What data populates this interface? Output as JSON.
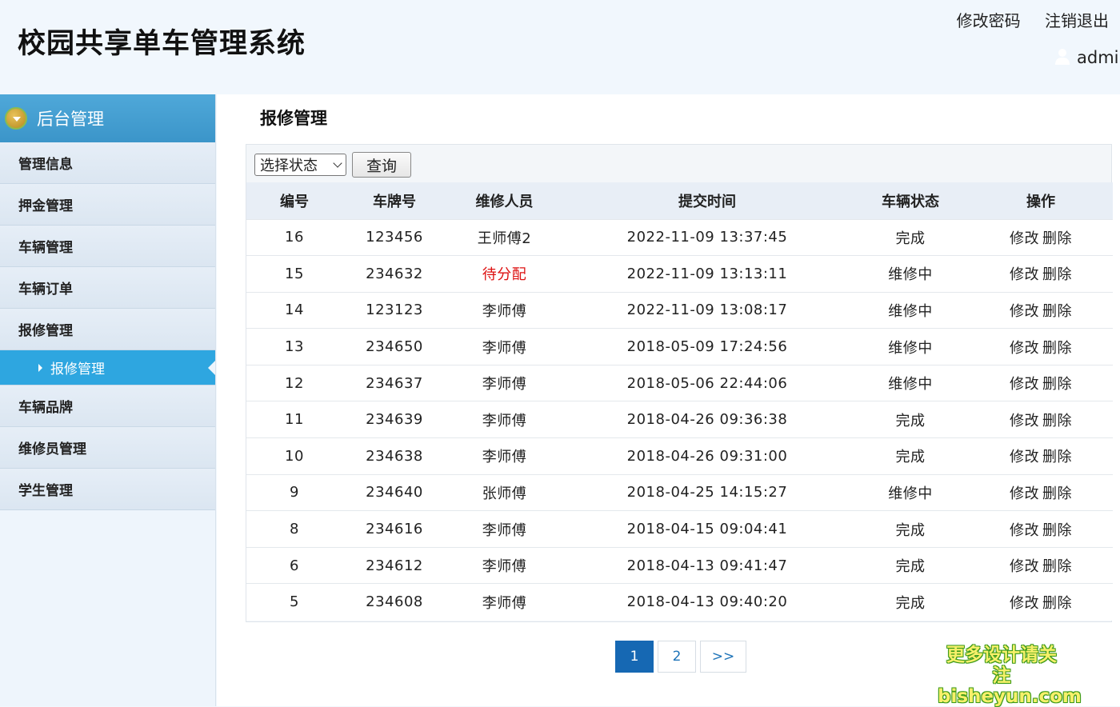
{
  "header": {
    "title": "校园共享单车管理系统",
    "change_password": "修改密码",
    "logout": "注销退出",
    "username": "admi"
  },
  "sidebar": {
    "head": "后台管理",
    "items": [
      {
        "label": "管理信息"
      },
      {
        "label": "押金管理"
      },
      {
        "label": "车辆管理"
      },
      {
        "label": "车辆订单"
      },
      {
        "label": "报修管理"
      },
      {
        "label": "车辆品牌"
      },
      {
        "label": "维修员管理"
      },
      {
        "label": "学生管理"
      }
    ],
    "active_sub": "报修管理"
  },
  "main": {
    "title": "报修管理",
    "filter": {
      "selected": "选择状态",
      "query_label": "查询"
    },
    "columns": [
      "编号",
      "车牌号",
      "维修人员",
      "提交时间",
      "车辆状态",
      "操作"
    ],
    "rows": [
      {
        "id": "16",
        "plate": "123456",
        "repairer": "王师傅2",
        "time": "2022-11-09 13:37:45",
        "status": "完成"
      },
      {
        "id": "15",
        "plate": "234632",
        "repairer": "待分配",
        "time": "2022-11-09 13:13:11",
        "status": "维修中"
      },
      {
        "id": "14",
        "plate": "123123",
        "repairer": "李师傅",
        "time": "2022-11-09 13:08:17",
        "status": "维修中"
      },
      {
        "id": "13",
        "plate": "234650",
        "repairer": "李师傅",
        "time": "2018-05-09 17:24:56",
        "status": "维修中"
      },
      {
        "id": "12",
        "plate": "234637",
        "repairer": "李师傅",
        "time": "2018-05-06 22:44:06",
        "status": "维修中"
      },
      {
        "id": "11",
        "plate": "234639",
        "repairer": "李师傅",
        "time": "2018-04-26 09:36:38",
        "status": "完成"
      },
      {
        "id": "10",
        "plate": "234638",
        "repairer": "李师傅",
        "time": "2018-04-26 09:31:00",
        "status": "完成"
      },
      {
        "id": "9",
        "plate": "234640",
        "repairer": "张师傅",
        "time": "2018-04-25 14:15:27",
        "status": "维修中"
      },
      {
        "id": "8",
        "plate": "234616",
        "repairer": "李师傅",
        "time": "2018-04-15 09:04:41",
        "status": "完成"
      },
      {
        "id": "6",
        "plate": "234612",
        "repairer": "李师傅",
        "time": "2018-04-13 09:41:47",
        "status": "完成"
      },
      {
        "id": "5",
        "plate": "234608",
        "repairer": "李师傅",
        "time": "2018-04-13 09:40:20",
        "status": "完成"
      }
    ],
    "actions": {
      "edit": "修改",
      "delete": "删除"
    },
    "pagination": {
      "pages": [
        "1",
        "2"
      ],
      "current": "1",
      "next": ">>"
    }
  },
  "watermark": {
    "line1": "更多设计请关注",
    "line2": "bisheyun.com"
  },
  "colors": {
    "accent": "#2ea6e0",
    "unassigned": "#dd1111",
    "page_active": "#1668b3"
  }
}
